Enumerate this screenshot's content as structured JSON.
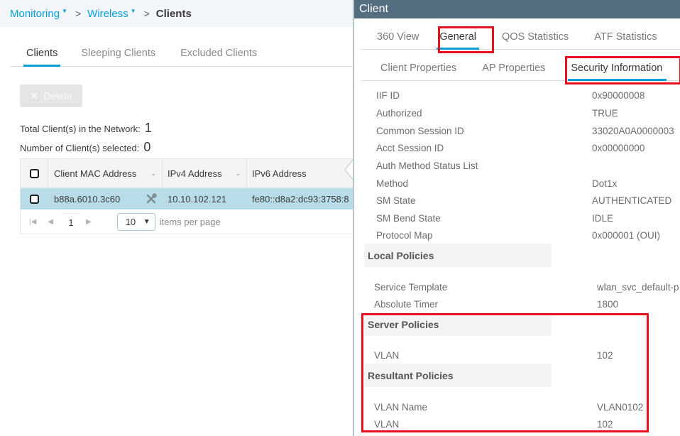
{
  "breadcrumb": {
    "items": [
      {
        "label": "Monitoring",
        "has_dropdown": true
      },
      {
        "label": "Wireless",
        "has_dropdown": true
      }
    ],
    "separator": ">",
    "current": "Clients"
  },
  "tabs": [
    {
      "label": "Clients",
      "active": true
    },
    {
      "label": "Sleeping Clients",
      "active": false
    },
    {
      "label": "Excluded Clients",
      "active": false
    }
  ],
  "toolbar": {
    "delete_label": "Delete",
    "delete_icon": "close-icon",
    "delete_enabled": false
  },
  "stats": {
    "total_label": "Total Client(s) in the Network:",
    "total_value": "1",
    "selected_label": "Number of Client(s) selected:",
    "selected_value": "0"
  },
  "grid": {
    "columns": [
      "Client MAC Address",
      "IPv4 Address",
      "IPv6 Address"
    ],
    "rows": [
      {
        "mac": "b88a.6010.3c60",
        "ipv4": "10.10.102.121",
        "ipv6": "fe80::d8a2:dc93:3758:8",
        "icon": "tools-icon",
        "selected": false,
        "highlighted": true
      }
    ],
    "pager": {
      "current_page": "1",
      "page_size": "10",
      "page_size_label": "items per page"
    }
  },
  "panel": {
    "title": "Client",
    "tabs": [
      {
        "label": "360 View",
        "active": false
      },
      {
        "label": "General",
        "active": true
      },
      {
        "label": "QOS Statistics",
        "active": false
      },
      {
        "label": "ATF Statistics",
        "active": false
      }
    ],
    "subtabs": [
      {
        "label": "Client Properties",
        "active": false
      },
      {
        "label": "AP Properties",
        "active": false
      },
      {
        "label": "Security Information",
        "active": true
      }
    ],
    "properties": [
      {
        "key": "IIF ID",
        "value": "0x90000008"
      },
      {
        "key": "Authorized",
        "value": "TRUE"
      },
      {
        "key": "Common Session ID",
        "value": "33020A0A0000003"
      },
      {
        "key": "Acct Session ID",
        "value": "0x00000000"
      },
      {
        "key": "Auth Method Status List",
        "value": ""
      },
      {
        "key": "Method",
        "value": "Dot1x"
      },
      {
        "key": "SM State",
        "value": "AUTHENTICATED"
      },
      {
        "key": "SM Bend State",
        "value": "IDLE"
      },
      {
        "key": "Protocol Map",
        "value": "0x000001 (OUI)"
      }
    ],
    "local_policies": {
      "title": "Local Policies",
      "items": [
        {
          "key": "Service Template",
          "value": "wlan_svc_default-p"
        },
        {
          "key": "Absolute Timer",
          "value": "1800"
        }
      ]
    },
    "server_policies": {
      "title": "Server Policies",
      "items": [
        {
          "key": "VLAN",
          "value": "102"
        }
      ]
    },
    "resultant_policies": {
      "title": "Resultant Policies",
      "items": [
        {
          "key": "VLAN Name",
          "value": "VLAN0102"
        },
        {
          "key": "VLAN",
          "value": "102"
        }
      ]
    }
  },
  "colors": {
    "accent": "#049fd9",
    "panel_header": "#546e80",
    "highlight_box": "#e8111f",
    "selected_row": "#b9dde8"
  }
}
